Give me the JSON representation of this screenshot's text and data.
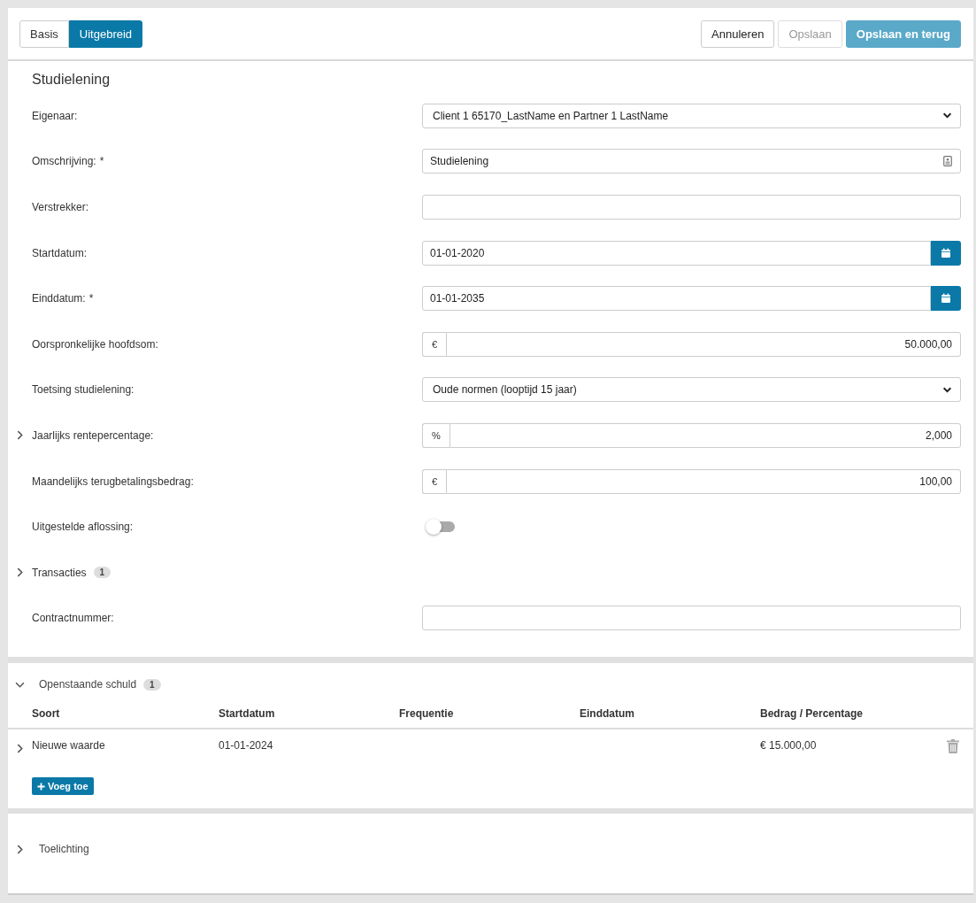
{
  "toolbar": {
    "view_tabs": [
      {
        "label": "Basis",
        "selected": false
      },
      {
        "label": "Uitgebreid",
        "selected": true
      }
    ],
    "buttons": [
      {
        "label": "Annuleren",
        "kind": "default",
        "disabled": false
      },
      {
        "label": "Opslaan",
        "kind": "default",
        "disabled": true
      },
      {
        "label": "Opslaan en terug",
        "kind": "primary",
        "disabled": true
      }
    ]
  },
  "form": {
    "title": "Studielening",
    "fields": [
      {
        "label": "Eigenaar:",
        "kind": "select",
        "value": "Client 1 65170_LastName en Partner 1 LastName"
      },
      {
        "label": "Omschrijving:",
        "required_mark": "*",
        "kind": "text",
        "value": "Studielening",
        "suffix_icon": true
      },
      {
        "label": "Verstrekker:",
        "kind": "text"
      },
      {
        "label": "Startdatum:",
        "kind": "date",
        "value": "01-01-2020"
      },
      {
        "label": "Einddatum:",
        "required_mark": "*",
        "kind": "date",
        "value": "01-01-2035"
      },
      {
        "label": "Oorspronkelijke hoofdsom:",
        "kind": "addon",
        "prefix": "€",
        "value": "50.000,00"
      },
      {
        "label": "Toetsing studielening:",
        "kind": "select",
        "value": "Oude normen (looptijd 15 jaar)"
      },
      {
        "label": "Jaarlijks rentepercentage:",
        "kind": "addon",
        "prefix": "%",
        "value": "2,000",
        "expanded": false
      },
      {
        "label": "Maandelijks terugbetalingsbedrag:",
        "kind": "addon",
        "prefix": "€",
        "value": "100,00"
      },
      {
        "label": "Uitgestelde aflossing:",
        "kind": "toggle",
        "on": false
      },
      {
        "label": "Transacties",
        "kind": "group",
        "badge": "1",
        "expanded": false
      },
      {
        "label": "Contractnummer:",
        "kind": "text"
      }
    ]
  },
  "debt": {
    "title": "Openstaande schuld",
    "badge": "1",
    "expanded": true,
    "columns": [
      "Soort",
      "Startdatum",
      "Frequentie",
      "Einddatum",
      "Bedrag / Percentage"
    ],
    "rows": [
      {
        "expanded": false,
        "cells": [
          "Nieuwe waarde",
          "01-01-2024",
          null,
          null,
          "€ 15.000,00"
        ]
      }
    ],
    "add_button": "Voeg toe"
  },
  "notes": {
    "title": "Toelichting",
    "expanded": false
  }
}
